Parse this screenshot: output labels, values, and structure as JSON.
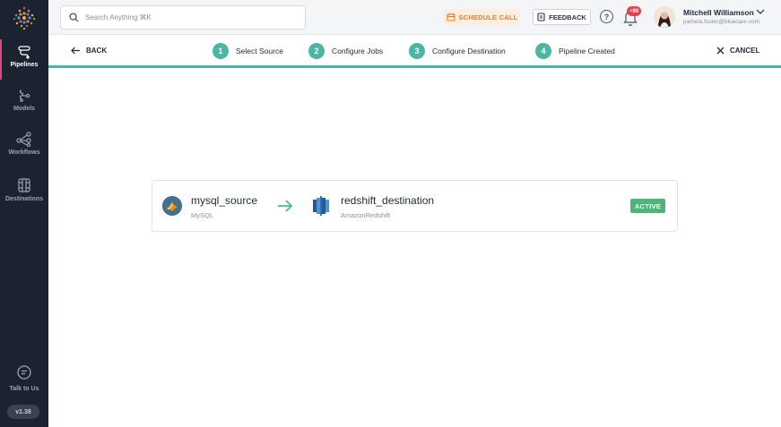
{
  "sidebar": {
    "items": [
      {
        "label": "Pipelines",
        "icon": "pipelines-icon",
        "active": true
      },
      {
        "label": "Models",
        "icon": "models-icon",
        "active": false
      },
      {
        "label": "Workflows",
        "icon": "workflows-icon",
        "active": false
      },
      {
        "label": "Destinations",
        "icon": "destinations-icon",
        "active": false
      }
    ],
    "talk_label": "Talk to Us",
    "version": "v1.38"
  },
  "topbar": {
    "search_placeholder": "Search Anything ⌘K",
    "schedule_call": "SCHEDULE CALL",
    "feedback": "FEEDBACK",
    "help": "?",
    "notification_count": "+99",
    "user_name": "Mitchell Williamson",
    "user_email": "pamela.foster@bluecare.com"
  },
  "wizard": {
    "back": "BACK",
    "cancel": "CANCEL",
    "steps": [
      {
        "num": "1",
        "label": "Select Source"
      },
      {
        "num": "2",
        "label": "Configure Jobs"
      },
      {
        "num": "3",
        "label": "Configure Destination"
      },
      {
        "num": "4",
        "label": "Pipeline Created"
      }
    ]
  },
  "pipeline": {
    "source_name": "mysql_source",
    "source_type": "MySQL",
    "destination_name": "redshift_destination",
    "destination_type": "AmazonRedshift",
    "status": "ACTIVE"
  },
  "colors": {
    "accent": "#4cb6a4",
    "sidebar_bg": "#1c2330",
    "active_badge": "#4cb67a",
    "schedule_text": "#e97b2d",
    "nav_highlight": "#e0457b"
  }
}
